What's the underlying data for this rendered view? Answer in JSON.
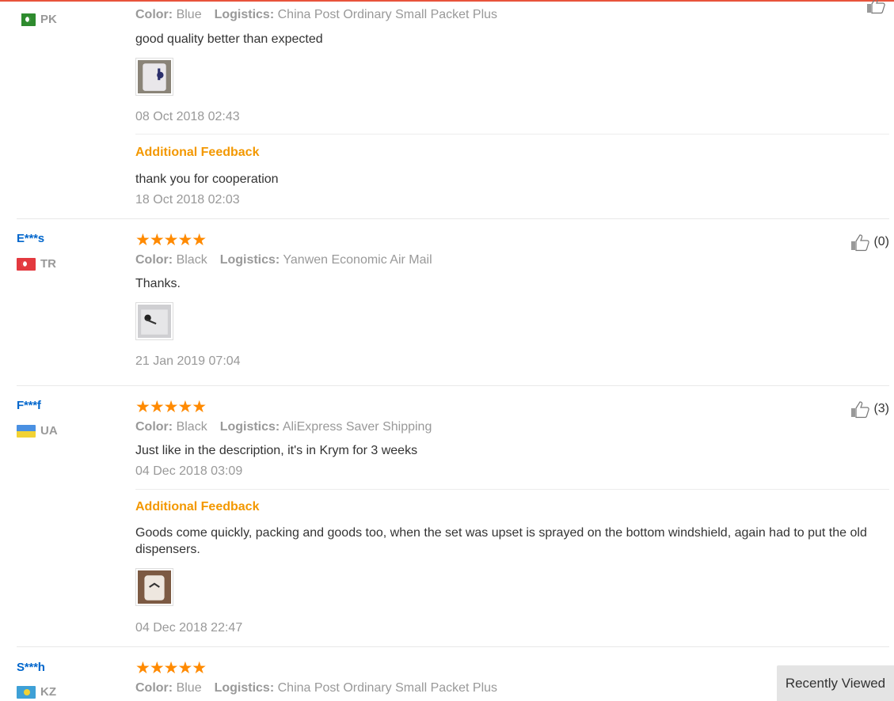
{
  "reviews": [
    {
      "user": "",
      "country": "PK",
      "color_label": "Color:",
      "color": "Blue",
      "logistics_label": "Logistics:",
      "logistics": "China Post Ordinary Small Packet Plus",
      "text": "good quality better than expected",
      "date": "08 Oct 2018 02:43",
      "additional_label": "Additional Feedback",
      "additional_text": "thank you for cooperation",
      "additional_date": "18 Oct 2018 02:03",
      "helpful": ""
    },
    {
      "user": "E***s",
      "country": "TR",
      "rating": 5,
      "color_label": "Color:",
      "color": "Black",
      "logistics_label": "Logistics:",
      "logistics": "Yanwen Economic Air Mail",
      "text": "Thanks.",
      "date": "21 Jan 2019 07:04",
      "helpful": "(0)"
    },
    {
      "user": "F***f",
      "country": "UA",
      "rating": 5,
      "color_label": "Color:",
      "color": "Black",
      "logistics_label": "Logistics:",
      "logistics": "AliExpress Saver Shipping",
      "text": "Just like in the description, it's in Krym for 3 weeks",
      "date": "04 Dec 2018 03:09",
      "additional_label": "Additional Feedback",
      "additional_text": "Goods come quickly, packing and goods too, when the set was upset is sprayed on the bottom windshield, again had to put the old dispensers.",
      "additional_date": "04 Dec 2018 22:47",
      "helpful": "(3)"
    },
    {
      "user": "S***h",
      "country": "KZ",
      "rating": 5,
      "color_label": "Color:",
      "color": "Blue",
      "logistics_label": "Logistics:",
      "logistics": "China Post Ordinary Small Packet Plus"
    }
  ],
  "stars_glyph": "★★★★★",
  "recently_viewed": "Recently Viewed",
  "colors": {
    "accent": "#ff8a00",
    "link": "#0066cc",
    "feedback": "#f39800"
  }
}
